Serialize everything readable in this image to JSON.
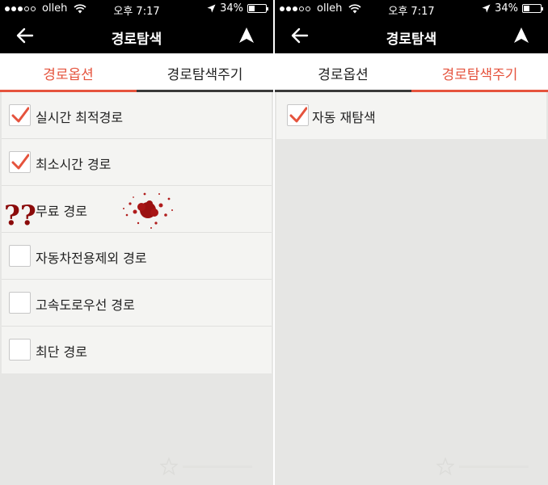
{
  "status": {
    "carrier": "olleh",
    "time": "오후 7:17",
    "battery": "34%",
    "battery_level": 0.34
  },
  "header": {
    "title": "경로탐색"
  },
  "tabs": [
    {
      "label": "경로옵션"
    },
    {
      "label": "경로탐색주기"
    }
  ],
  "left_panel": {
    "active_tab": 0,
    "options": [
      {
        "label": "실시간 최적경로",
        "checked": true
      },
      {
        "label": "최소시간 경로",
        "checked": true
      },
      {
        "label": "무료 경로",
        "checked": false,
        "annotation": "????"
      },
      {
        "label": "자동차전용제외 경로",
        "checked": false
      },
      {
        "label": "고속도로우선 경로",
        "checked": false
      },
      {
        "label": "최단 경로",
        "checked": false
      }
    ]
  },
  "right_panel": {
    "active_tab": 1,
    "options": [
      {
        "label": "자동 재탐색",
        "checked": true
      }
    ]
  },
  "colors": {
    "accent": "#e5533d",
    "header_bg": "#000000",
    "page_bg": "#e6e6e4",
    "annotation": "#8b0a0a"
  },
  "icons": {
    "back": "arrow-left-icon",
    "navigation": "navigation-arrow-icon",
    "check": "checkmark-icon",
    "watermark": "star-logo-icon"
  }
}
